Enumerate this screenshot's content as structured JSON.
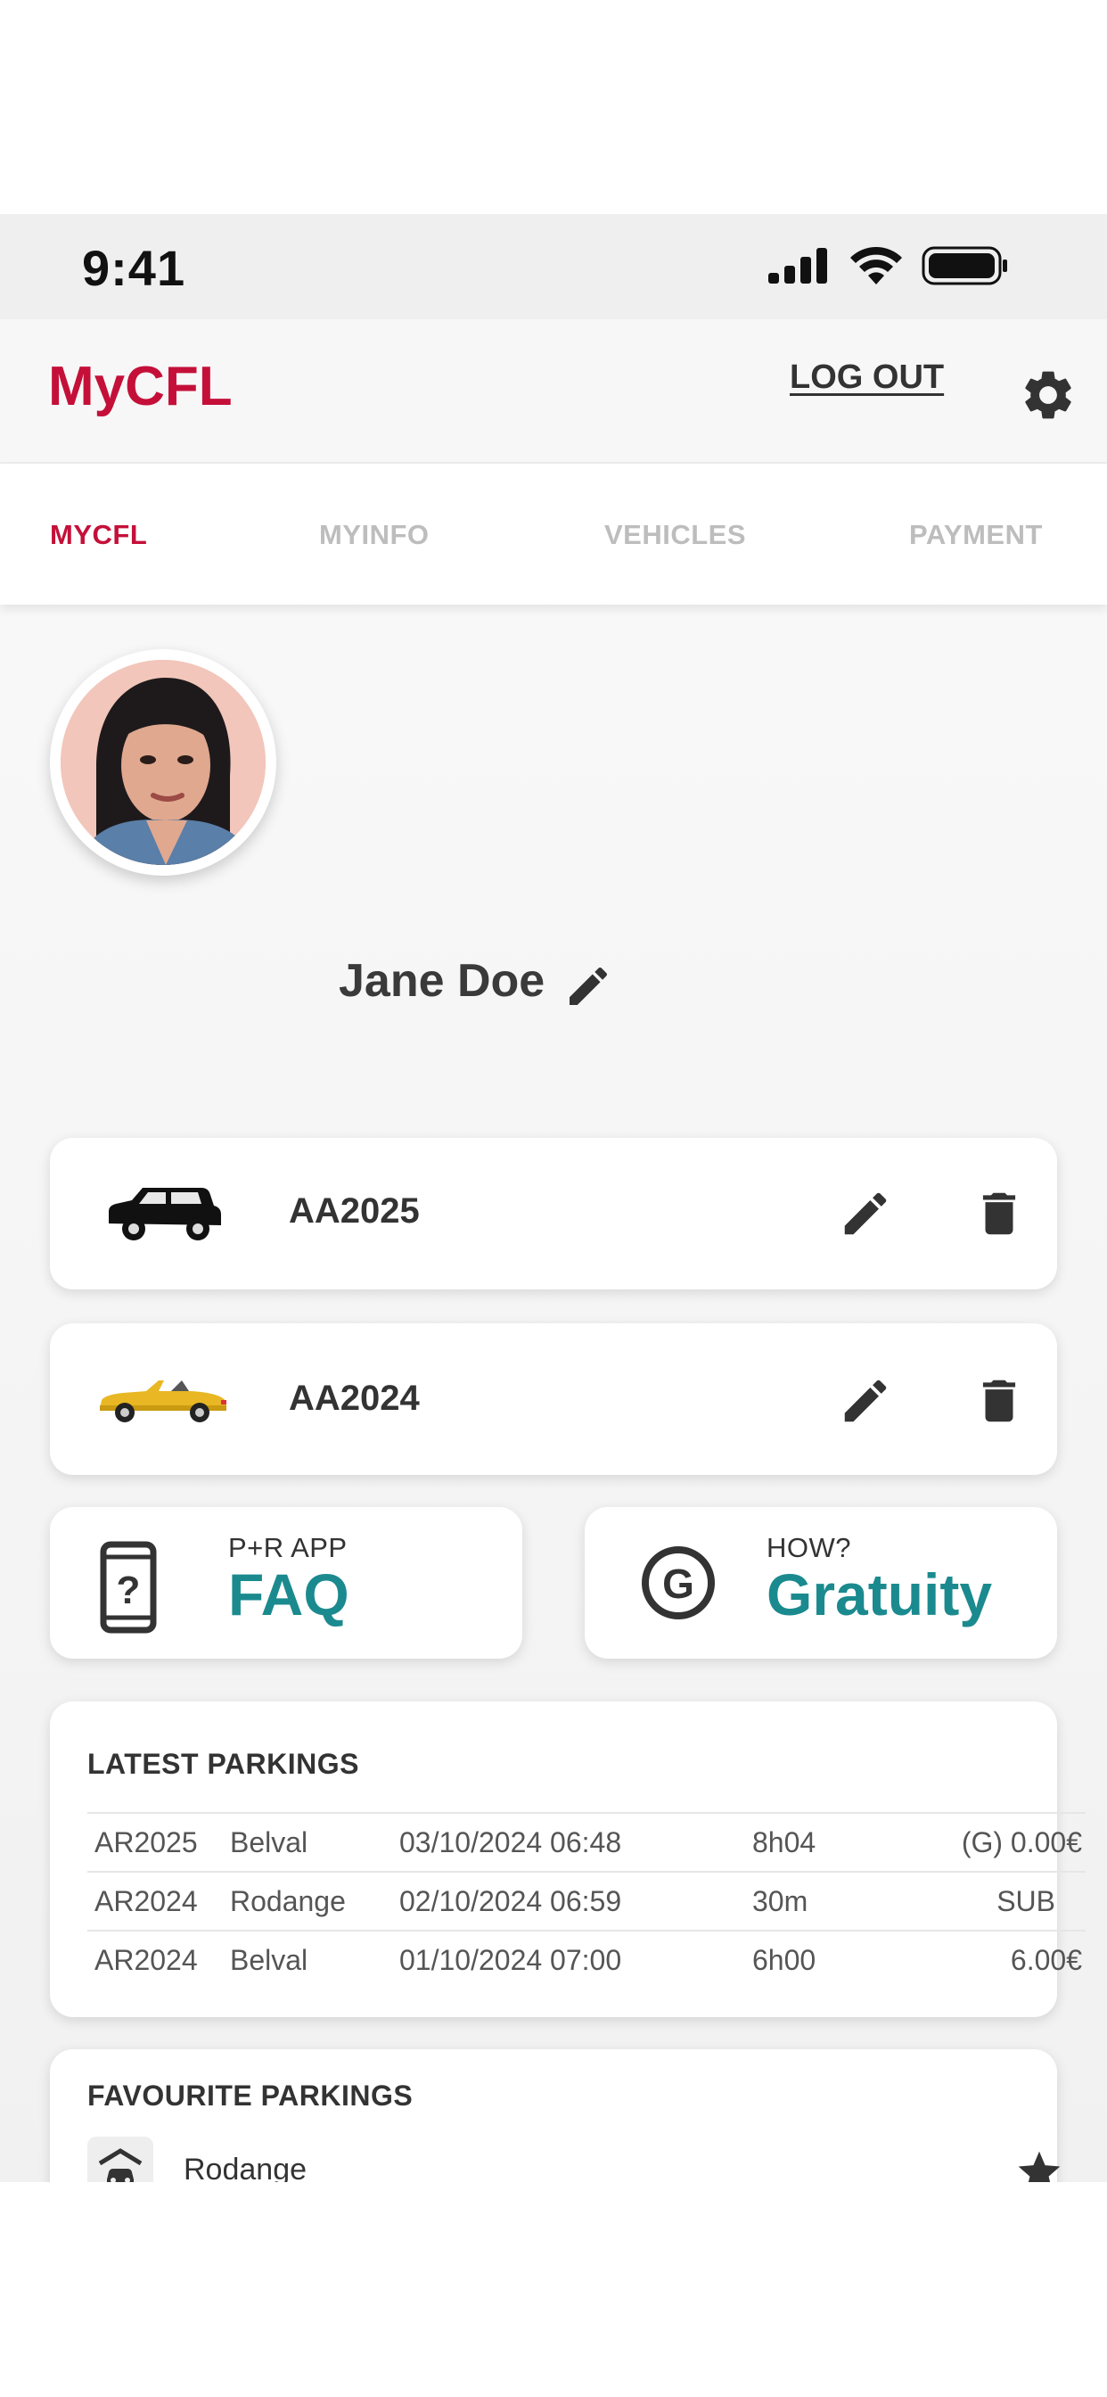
{
  "status_bar": {
    "time": "9:41"
  },
  "header": {
    "brand": "MyCFL",
    "logout_label": "LOG OUT"
  },
  "tabs": [
    {
      "label": "MYCFL",
      "active": true
    },
    {
      "label": "MYINFO",
      "active": false
    },
    {
      "label": "VEHICLES",
      "active": false
    },
    {
      "label": "PAYMENT",
      "active": false
    }
  ],
  "profile": {
    "name": "Jane Doe"
  },
  "vehicles": [
    {
      "plate": "AA2025",
      "icon": "black-suv-icon"
    },
    {
      "plate": "AA2024",
      "icon": "yellow-convertible-icon"
    }
  ],
  "info_cards": {
    "faq": {
      "small": "P+R APP",
      "big": "FAQ",
      "icon": "phone-question-icon"
    },
    "gratuity": {
      "small": "HOW?",
      "big": "Gratuity",
      "icon": "circled-g-icon"
    }
  },
  "latest_parkings": {
    "title": "LATEST PARKINGS",
    "rows": [
      {
        "plate": "AR2025",
        "location": "Belval",
        "datetime": "03/10/2024 06:48",
        "duration": "8h04",
        "price": "(G) 0.00€"
      },
      {
        "plate": "AR2024",
        "location": "Rodange",
        "datetime": "02/10/2024 06:59",
        "duration": "30m",
        "price": "SUB"
      },
      {
        "plate": "AR2024",
        "location": "Belval",
        "datetime": "01/10/2024 07:00",
        "duration": "6h00",
        "price": "6.00€"
      }
    ]
  },
  "favourite_parkings": {
    "title": "FAVOURITE PARKINGS",
    "items": [
      {
        "name": "Rodange"
      }
    ]
  },
  "bottom_nav": {
    "items": [
      "profile-icon",
      "train-icon",
      "car-icon",
      "ticket-star-icon",
      "history-icon"
    ],
    "active": "profile-icon"
  },
  "colors": {
    "brand": "#c41039",
    "accent": "#1b8a8f",
    "text": "#3a3a3a"
  }
}
